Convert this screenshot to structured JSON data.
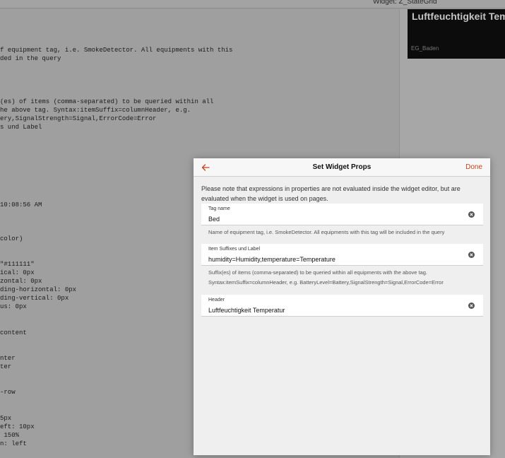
{
  "background": {
    "window_title": "Widget: Z_StateGrid",
    "preview": {
      "title": "Luftfeuchtigkeit Tem",
      "subtitle": "EG_Baden"
    },
    "code_lines": [
      "f equipment tag, i.e. SmokeDetector. All equipments with this",
      "ded in the query",
      "(es) of items (comma-separated) to be queried within all",
      "he above tag. Syntax:itemSuffix=columnHeader, e.g.",
      "ery,SignalStrength=Signal,ErrorCode=Error",
      "s und Label",
      "10:08:56 AM",
      "color)",
      "\"#111111\"",
      "ical: 0px",
      "zontal: 0px",
      "ding-horizontal: 0px",
      "ding-vertical: 0px",
      "us: 0px",
      "content",
      "nter",
      "ter",
      "-row",
      "5px",
      "eft: 10px",
      " 150%",
      "n: left"
    ]
  },
  "dialog": {
    "title": "Set Widget Props",
    "done_label": "Done",
    "note": "Please note that expressions in properties are not evaluated inside the widget editor, but are evaluated when the widget is used on pages.",
    "fields": [
      {
        "label": "Tag name",
        "value": "Bed",
        "helper": [
          "Name of equipment tag, i.e. SmokeDetector. All equipments with this tag will be included in the query"
        ]
      },
      {
        "label": "Item Suffixes und Label",
        "value": "humidity=Humidity,temperature=Temperature",
        "helper": [
          "Suffix(es) of items (comma-separated) to be queried within all equipments with the above tag.",
          "Syntax:itemSuffix=columnHeader, e.g. BatteryLevel=Battery,SignalStrength=Signal,ErrorCode=Error"
        ]
      },
      {
        "label": "Header",
        "value": "Luftfeuchtigkeit Temperatur",
        "helper": []
      }
    ]
  },
  "icons": {
    "back": "arrow-left-icon",
    "clear": "clear-circle-icon"
  },
  "colors": {
    "accent": "#c5421a",
    "preview_bg": "#0c0c0c"
  }
}
